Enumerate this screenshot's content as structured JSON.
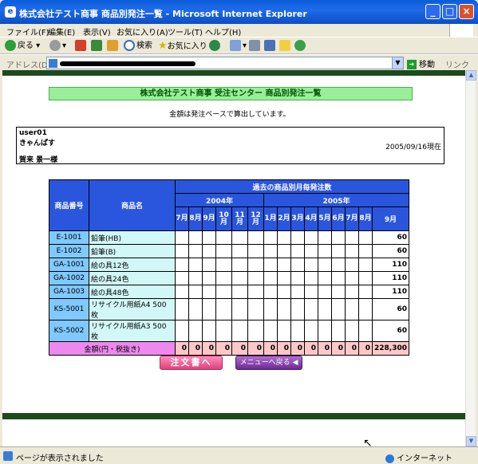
{
  "window": {
    "title": "株式会社テスト商事 商品別発注一覧 - Microsoft Internet Explorer",
    "icon_name": "ie-icon"
  },
  "menu": [
    "ファイル(F)",
    "編集(E)",
    "表示(V)",
    "お気に入り(A)",
    "ツール(T)",
    "ヘルプ(H)"
  ],
  "toolbar": {
    "back": "戻る",
    "search": "検索",
    "favorites": "お気に入り"
  },
  "address": {
    "label": "アドレス(D)",
    "go": "移動",
    "links": "リンク"
  },
  "page": {
    "heading": "株式会社テスト商事 受注センター 商品別発注一覧",
    "note": "金額は発注ベースで算出しています。",
    "user_id": "user01",
    "user_company": "きゃんぱす",
    "user_name": "賀来 景一様",
    "as_of": "2005/09/16現在"
  },
  "table": {
    "col_code": "商品番号",
    "col_name": "商品名",
    "col_group": "過去の商品別月毎発注数",
    "year1": "2004年",
    "year2": "2005年",
    "months1": [
      "7月",
      "8月",
      "9月",
      "10月",
      "11月",
      "12月"
    ],
    "months2": [
      "1月",
      "2月",
      "3月",
      "4月",
      "5月",
      "6月",
      "7月",
      "8月"
    ],
    "last_month": "9月",
    "rows": [
      {
        "code": "E-1001",
        "name": "鉛筆(HB)",
        "total": "60"
      },
      {
        "code": "E-1002",
        "name": "鉛筆(B)",
        "total": "60"
      },
      {
        "code": "GA-1001",
        "name": "絵の具12色",
        "total": "110"
      },
      {
        "code": "GA-1002",
        "name": "絵の具24色",
        "total": "110"
      },
      {
        "code": "GA-1003",
        "name": "絵の具48色",
        "total": "110"
      },
      {
        "code": "KS-5001",
        "name": "リサイクル用紙A4 500枚",
        "total": "60"
      },
      {
        "code": "KS-5002",
        "name": "リサイクル用紙A3 500枚",
        "total": "60"
      }
    ],
    "total_label": "金額(円・税抜き)",
    "total_month_values": [
      "0",
      "0",
      "0",
      "0",
      "0",
      "0",
      "0",
      "0",
      "0",
      "0",
      "0",
      "0",
      "0",
      "0"
    ],
    "total_value": "228,300"
  },
  "buttons": {
    "order": "注文書へ",
    "menu": "メニューへ戻る ◀"
  },
  "status": {
    "text": "ページが表示されました",
    "zone": "インターネット"
  }
}
